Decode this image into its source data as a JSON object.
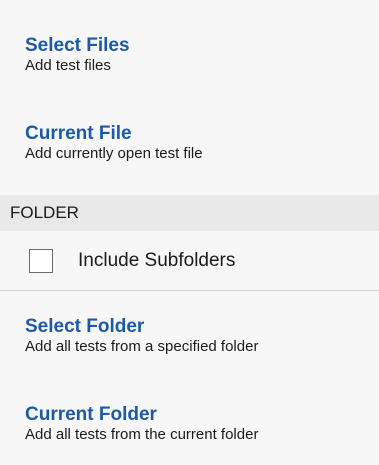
{
  "items": [
    {
      "title": "Select Files",
      "description": "Add test files"
    },
    {
      "title": "Current File",
      "description": "Add currently open test file"
    }
  ],
  "folder_section": {
    "header": "FOLDER",
    "include_subfolders": {
      "label": "Include Subfolders",
      "checked": false
    },
    "items": [
      {
        "title": "Select Folder",
        "description": "Add all tests from a specified folder"
      },
      {
        "title": "Current Folder",
        "description": "Add all tests from the current folder"
      }
    ]
  },
  "colors": {
    "accent": "#1c5aa8",
    "panel_bg": "#f7f7f7",
    "header_bg": "#e9e9e9"
  }
}
